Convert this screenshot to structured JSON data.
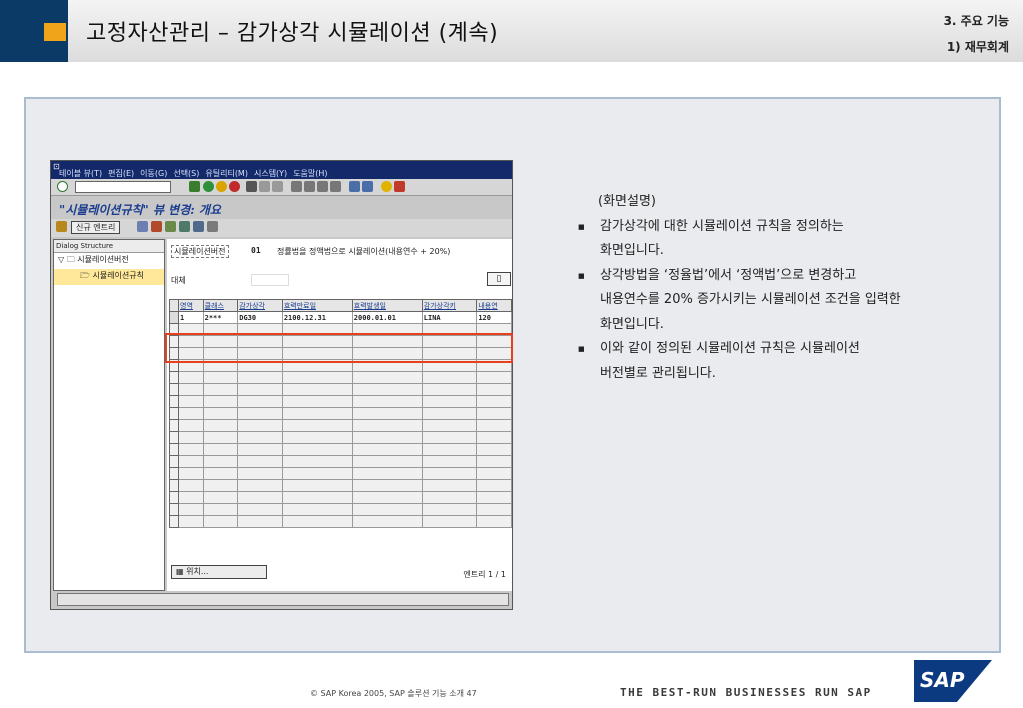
{
  "header": {
    "title": "고정자산관리 – 감가상각 시뮬레이션 (계속)",
    "section": "3. 주요 기능",
    "subsection": "1) 재무회계"
  },
  "sap": {
    "menu": [
      "테이블 뷰(T)",
      "편집(E)",
      "이동(G)",
      "선택(S)",
      "유틸리티(M)",
      "시스템(Y)",
      "도움말(H)"
    ],
    "screen_title": "\"시뮬레이션규칙\" 뷰 변경: 개요",
    "new_entry_button": "신규 엔트리",
    "tree": {
      "header": "Dialog Structure",
      "root": "시뮬레이션버전",
      "child": "시뮬레이션규칙"
    },
    "version_label": "시뮬레이션버전",
    "version_value": "01",
    "version_desc": "정률법을 정액법으로 시뮬레이션(내용연수 + 20%)",
    "substitute_label": "대체",
    "table": {
      "headers": [
        "영역",
        "클래스",
        "감가상각",
        "효력만료일",
        "효력발생일",
        "감가상각키",
        "내용연"
      ],
      "rows": [
        [
          "1",
          "2***",
          "DG30",
          "2100.12.31",
          "2000.01.01",
          "LINA",
          "120"
        ]
      ]
    },
    "position_button": "위치...",
    "entry_count": "엔트리 1 / 1"
  },
  "description": {
    "title": "(화면설명)",
    "bullets": [
      "감가상각에 대한 시뮬레이션 규칙을 정의하는\n화면입니다.",
      "상각방법을 ‘정율법’에서 ‘정액법’으로 변경하고\n내용연수를 20% 증가시키는 시뮬레이션 조건을 입력한\n화면입니다.",
      "이와 같이 정의된 시뮬레이션 규칙은 시뮬레이션\n버전별로 관리됩니다."
    ]
  },
  "footer": {
    "copyright": "© SAP Korea 2005, SAP 솔루션 기능 소개 47",
    "slogan": "THE BEST-RUN BUSINESSES RUN SAP",
    "logo_text": "SAP"
  },
  "colors": {
    "header_blue": "#0b3a66",
    "header_orange": "#f0a419",
    "highlight_red": "#e8401c",
    "sap_blue": "#0c3a80"
  }
}
